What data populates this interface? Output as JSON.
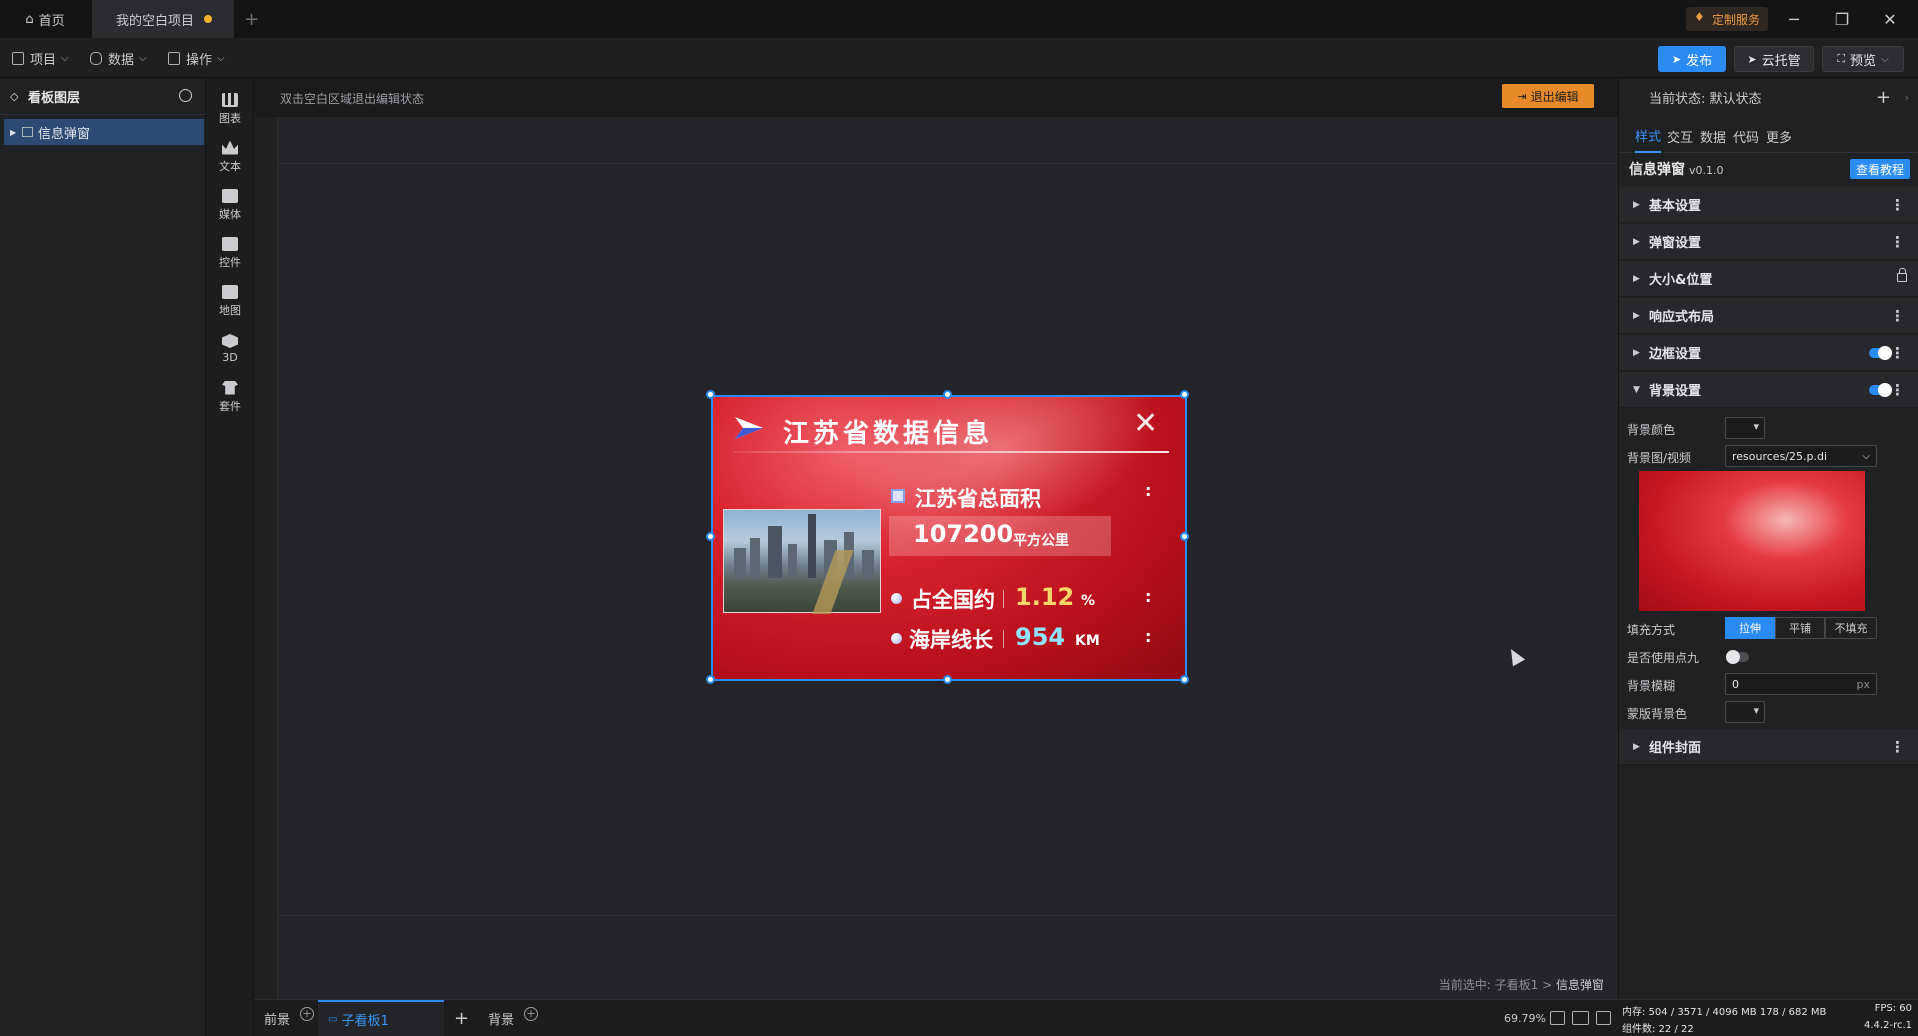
{
  "titlebar": {
    "home_tab": "首页",
    "project_tab": "我的空白项目",
    "custom_service": "定制服务"
  },
  "menubar": {
    "project": "项目",
    "data": "数据",
    "operate": "操作",
    "publish": "发布",
    "cloud_host": "云托管",
    "preview": "预览"
  },
  "layers": {
    "title": "看板图层",
    "items": [
      {
        "label": "信息弹窗"
      }
    ]
  },
  "strip": {
    "items": [
      {
        "label": "图表",
        "icon": "chart-icon"
      },
      {
        "label": "文本",
        "icon": "text-icon"
      },
      {
        "label": "媒体",
        "icon": "media-icon"
      },
      {
        "label": "控件",
        "icon": "control-icon"
      },
      {
        "label": "地图",
        "icon": "map-icon"
      },
      {
        "label": "3D",
        "icon": "cube-icon"
      },
      {
        "label": "套件",
        "icon": "suit-icon"
      }
    ]
  },
  "canvas": {
    "hint": "双击空白区域退出编辑状态",
    "exit_edit": "退出编辑",
    "selected_prefix": "当前选中: 子看板1 > ",
    "selected_item": "信息弹窗"
  },
  "widget": {
    "title": "江苏省数据信息",
    "area_label": "江苏省总面积",
    "area_value": "107200",
    "area_unit": "平方公里",
    "share_label": "占全国约",
    "share_value": "1.12",
    "share_unit": "%",
    "coast_label": "海岸线长",
    "coast_value": "954",
    "coast_unit": "KM",
    "colon": ":",
    "colors": {
      "share_value": "#f7d66b",
      "coast_value": "#8fe3ff"
    }
  },
  "bottombar": {
    "foreground": "前景",
    "sub_board": "子看板1",
    "background": "背景",
    "zoom": "69.79%"
  },
  "rightpanel": {
    "current_state": "当前状态:  默认状态",
    "tabs": [
      "样式",
      "交互",
      "数据",
      "代码",
      "更多"
    ],
    "component_name": "信息弹窗",
    "version": "v0.1.0",
    "tutorial": "查看教程",
    "sections": {
      "basic": "基本设置",
      "popup": "弹窗设置",
      "size_pos": "大小&位置",
      "responsive": "响应式布局",
      "border": "边框设置",
      "background": "背景设置",
      "cover": "组件封面"
    },
    "bg": {
      "color_label": "背景颜色",
      "image_label": "背景图/视频",
      "image_value": "resources/25.p.di",
      "fill_label": "填充方式",
      "fill_options": [
        "拉伸",
        "平铺",
        "不填充"
      ],
      "ninepatch_label": "是否使用点九",
      "blur_label": "背景模糊",
      "blur_value": "0",
      "blur_unit": "px",
      "mask_label": "蒙版背景色"
    }
  },
  "statusbar": {
    "memory": "内存:  504 / 3571 / 4096 MB  178 / 682 MB",
    "fps": "FPS:  60",
    "components": "组件数: 22 / 22",
    "version": "4.4.2-rc.1"
  }
}
